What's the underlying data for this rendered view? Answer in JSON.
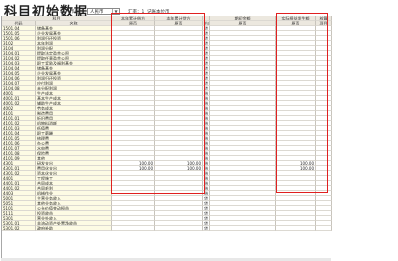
{
  "window": {
    "title": "科目初始数据"
  },
  "toolbar": {
    "currency_label": "币别：",
    "currency_value": "人民币",
    "rate_label": "汇率：1",
    "rate_note": "记账本位币"
  },
  "grid": {
    "header_groups": {
      "subject": "科目",
      "begin_balance_debit": "本年累计借方",
      "begin_balance_credit": "本年累计贷方",
      "period_balance": "期初余额",
      "actual_gain_loss": "实际损益发生额",
      "check": "核算"
    },
    "columns": {
      "code": "代码",
      "name": "名称",
      "yuan1": "原币",
      "yuan2": "原币",
      "direction": "方向",
      "yuan3": "原币",
      "yuan4": "原币",
      "project": "项目"
    },
    "rows": [
      {
        "code": "1501.04",
        "name": "储备基金",
        "d": "贷"
      },
      {
        "code": "1501.05",
        "name": "企业发展基金",
        "d": "贷"
      },
      {
        "code": "1501.06",
        "name": "利润归还投资",
        "d": "贷"
      },
      {
        "code": "3102",
        "name": "本年利润",
        "d": "贷"
      },
      {
        "code": "3104",
        "name": "利润分配",
        "d": "贷"
      },
      {
        "code": "3104.01",
        "name": "提取法定盈余公积",
        "d": "贷"
      },
      {
        "code": "3104.02",
        "name": "提取任意盈余公积",
        "d": "贷"
      },
      {
        "code": "3104.03",
        "name": "职工奖励及福利基金",
        "d": "贷"
      },
      {
        "code": "3104.04",
        "name": "储备基金",
        "d": "贷"
      },
      {
        "code": "3104.05",
        "name": "企业发展基金",
        "d": "贷"
      },
      {
        "code": "3104.06",
        "name": "利润归还投资",
        "d": "贷"
      },
      {
        "code": "3104.07",
        "name": "应付利润",
        "d": "贷"
      },
      {
        "code": "3104.08",
        "name": "未分配利润",
        "d": "贷"
      },
      {
        "code": "4001",
        "name": "生产成本",
        "d": "借"
      },
      {
        "code": "4001.01",
        "name": "基本生产成本",
        "d": "借"
      },
      {
        "code": "4001.02",
        "name": "辅助生产成本",
        "d": "借"
      },
      {
        "code": "4002",
        "name": "劳务成本",
        "d": "借"
      },
      {
        "code": "4101",
        "name": "制造费用",
        "d": "借"
      },
      {
        "code": "4101.01",
        "name": "折旧费用",
        "d": "借"
      },
      {
        "code": "4101.02",
        "name": "机物料消耗",
        "d": "借"
      },
      {
        "code": "4101.03",
        "name": "低值费",
        "d": "借"
      },
      {
        "code": "4101.04",
        "name": "职工薪酬",
        "d": "借"
      },
      {
        "code": "4101.05",
        "name": "修理费",
        "d": "借"
      },
      {
        "code": "4101.06",
        "name": "办公费",
        "d": "借"
      },
      {
        "code": "4101.07",
        "name": "水电费",
        "d": "借"
      },
      {
        "code": "4101.08",
        "name": "保险费",
        "d": "借"
      },
      {
        "code": "4101.09",
        "name": "其他",
        "d": "借"
      },
      {
        "code": "4301",
        "name": "研发支出",
        "d": "借",
        "v1": "100.00",
        "v2": "100.00",
        "v4": "100.00"
      },
      {
        "code": "4301.01",
        "name": "费用化支出",
        "d": "借",
        "v1": "100.00",
        "v2": "100.00",
        "v4": "100.00"
      },
      {
        "code": "4301.02",
        "name": "资本化支出",
        "d": "借"
      },
      {
        "code": "4401",
        "name": "工程施工",
        "d": "借"
      },
      {
        "code": "4401.01",
        "name": "合同成本",
        "d": "借"
      },
      {
        "code": "4401.02",
        "name": "合同毛利",
        "d": "借"
      },
      {
        "code": "4403",
        "name": "机械作业",
        "d": "借"
      },
      {
        "code": "5001",
        "name": "主营业务收入",
        "d": "贷"
      },
      {
        "code": "5051",
        "name": "其他业务收入",
        "d": "贷"
      },
      {
        "code": "5101",
        "name": "公允价值变动损益",
        "d": "贷"
      },
      {
        "code": "5111",
        "name": "投资收益",
        "d": "贷"
      },
      {
        "code": "5301",
        "name": "营业外收入",
        "d": "贷"
      },
      {
        "code": "5301.01",
        "name": "非流动资产处置净收益",
        "d": "贷"
      },
      {
        "code": "5301.02",
        "name": "政府补助",
        "d": "贷"
      }
    ]
  }
}
